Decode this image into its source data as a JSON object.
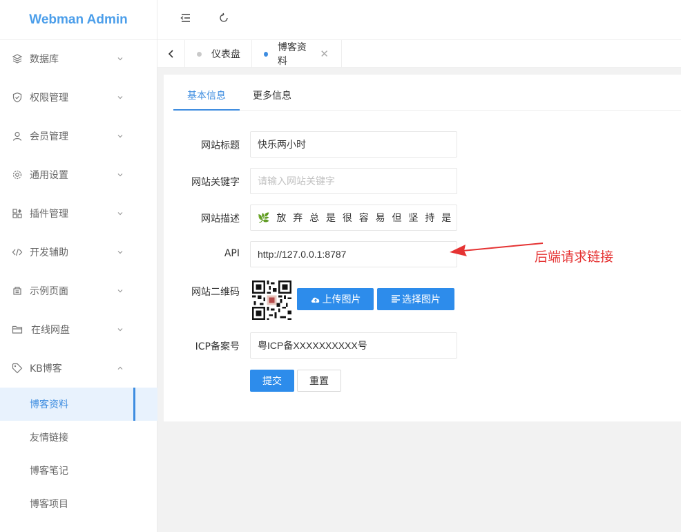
{
  "app": {
    "title": "Webman Admin"
  },
  "sidebar": {
    "items": [
      {
        "label": "数据库",
        "icon": "database-icon"
      },
      {
        "label": "权限管理",
        "icon": "shield-icon"
      },
      {
        "label": "会员管理",
        "icon": "user-icon"
      },
      {
        "label": "通用设置",
        "icon": "gear-icon"
      },
      {
        "label": "插件管理",
        "icon": "plugin-icon"
      },
      {
        "label": "开发辅助",
        "icon": "code-icon"
      },
      {
        "label": "示例页面",
        "icon": "template-icon"
      },
      {
        "label": "在线网盘",
        "icon": "folder-icon"
      },
      {
        "label": "KB博客",
        "icon": "tag-icon"
      }
    ],
    "submenu": [
      {
        "label": "博客资料",
        "active": true
      },
      {
        "label": "友情链接",
        "active": false
      },
      {
        "label": "博客笔记",
        "active": false
      },
      {
        "label": "博客项目",
        "active": false
      }
    ]
  },
  "tabs": [
    {
      "label": "仪表盘",
      "active": false
    },
    {
      "label": "博客资料",
      "active": true
    }
  ],
  "inner_tabs": [
    {
      "label": "基本信息",
      "active": true
    },
    {
      "label": "更多信息",
      "active": false
    }
  ],
  "form": {
    "title_label": "网站标题",
    "title_value": "快乐两小时",
    "keywords_label": "网站关键字",
    "keywords_placeholder": "请输入网站关键字",
    "desc_label": "网站描述",
    "desc_value": "🌿 放 弃 总 是 很 容 易 但 坚 持 是 痛 苦 的",
    "api_label": "API",
    "api_value": "http://127.0.0.1:8787",
    "qr_label": "网站二维码",
    "upload_label": "上传图片",
    "select_label": "选择图片",
    "icp_label": "ICP备案号",
    "icp_value": "粤ICP备XXXXXXXXXX号",
    "submit_label": "提交",
    "reset_label": "重置"
  },
  "annotation": {
    "text": "后端请求链接",
    "color": "#e53333"
  },
  "colors": {
    "accent": "#2d8ceb",
    "brand": "#4b9eea"
  }
}
